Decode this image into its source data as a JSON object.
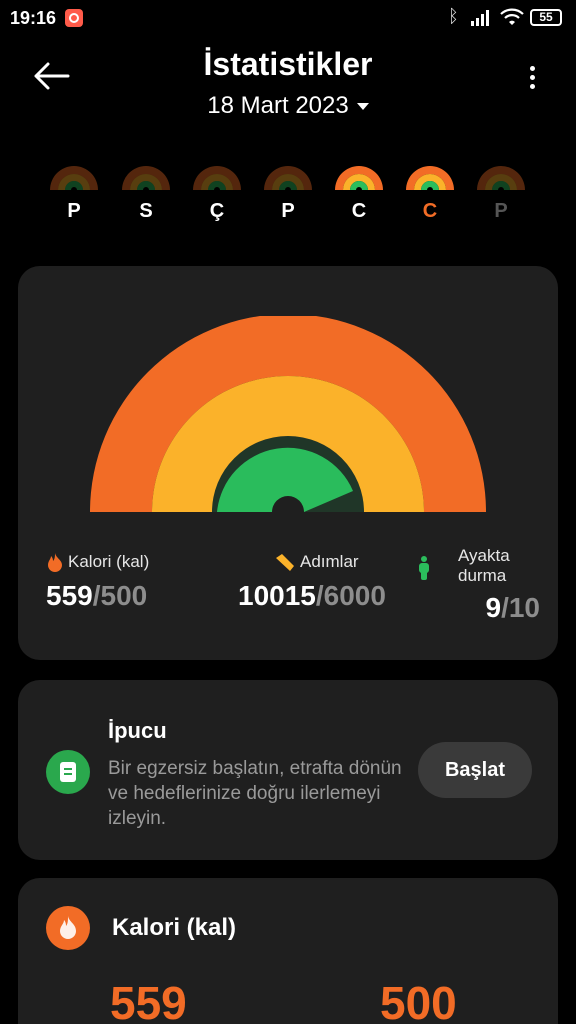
{
  "status_bar": {
    "time": "19:16",
    "battery": "55"
  },
  "header": {
    "title": "İstatistikler",
    "date": "18 Mart 2023"
  },
  "week": {
    "days": [
      {
        "label": "P",
        "state": "past"
      },
      {
        "label": "S",
        "state": "past"
      },
      {
        "label": "Ç",
        "state": "past"
      },
      {
        "label": "P",
        "state": "past"
      },
      {
        "label": "C",
        "state": "past"
      },
      {
        "label": "C",
        "state": "selected"
      },
      {
        "label": "P",
        "state": "future"
      }
    ]
  },
  "summary": {
    "rings": {
      "calories_progress": 1.0,
      "steps_progress": 1.0,
      "standing_progress": 0.9
    },
    "calories": {
      "label": "Kalori (kal)",
      "value": "559",
      "goal": "/500"
    },
    "steps": {
      "label": "Adımlar",
      "value": "10015",
      "goal": "/6000"
    },
    "standing": {
      "label": "Ayakta durma",
      "value": "9",
      "goal": "/10"
    }
  },
  "tip": {
    "title": "İpucu",
    "body": "Bir egzersiz başlatın, etrafta dönün ve hedeflerinize doğru ilerlemeyi izleyin.",
    "button": "Başlat"
  },
  "calorie_card": {
    "title": "Kalori (kal)",
    "value": "559",
    "goal": "500"
  },
  "colors": {
    "calories": "#f26c26",
    "steps": "#fbb22a",
    "standing": "#2bbd5c",
    "card": "#1f1f1f"
  },
  "icons": [
    "back-arrow-icon",
    "more-vert-icon",
    "flame-icon",
    "shoe-icon",
    "standing-person-icon",
    "note-icon"
  ]
}
